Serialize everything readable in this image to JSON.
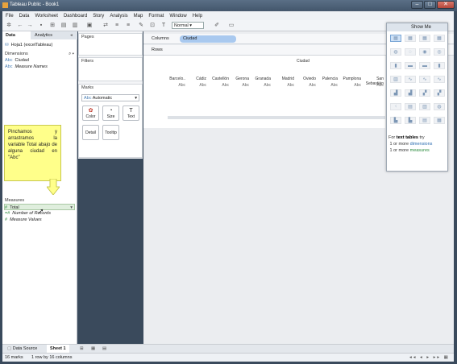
{
  "window": {
    "title": "Tableau Public - Book1"
  },
  "menu": [
    "File",
    "Data",
    "Worksheet",
    "Dashboard",
    "Story",
    "Analysis",
    "Map",
    "Format",
    "Window",
    "Help"
  ],
  "toolbar": {
    "fit_mode": "Normal"
  },
  "left_pane": {
    "tabs": [
      "Data",
      "Analytics"
    ],
    "datasource": "Hoja1 (excelTableau)",
    "dimensions_header": "Dimensions",
    "dimensions": [
      {
        "type": "Abc",
        "name": "Ciudad"
      },
      {
        "type": "Abc",
        "name": "Measure Names"
      }
    ],
    "measures_header": "Measures",
    "measures": [
      {
        "type": "#",
        "name": "Total"
      },
      {
        "type": "=#",
        "name": "Number of Records"
      },
      {
        "type": "#",
        "name": "Measure Values"
      }
    ]
  },
  "cards": {
    "pages": "Pages",
    "filters": "Filters",
    "marks": "Marks",
    "mark_type": "Automatic",
    "mark_type_icon": "Abc",
    "buttons": [
      "Color",
      "Size",
      "Text",
      "Detail",
      "Tooltip"
    ]
  },
  "shelves": {
    "columns_label": "Columns",
    "columns_pill": "Ciudad",
    "rows_label": "Rows"
  },
  "view": {
    "header": "Ciudad",
    "columns": [
      "Barcelo..",
      "Cádiz",
      "Castellón",
      "Gerona",
      "Granada",
      "Madrid",
      "Oviedo",
      "Palencia",
      "Pamplona",
      "San Sebastián"
    ],
    "cell_value": "Abc"
  },
  "show_me": {
    "title": "Show Me",
    "hint_prefix": "For",
    "hint_bold": "text tables",
    "hint_try": "try",
    "hint_line2_pre": "1 or more",
    "hint_line2_link": "dimensions",
    "hint_line3_pre": "1 or more",
    "hint_line3_link": "measures"
  },
  "callout": {
    "text": "Pinchamos y arrastramos la variable Total abajo de alguna ciudad en \"Abc\""
  },
  "sheet_tabs": {
    "data_source": "Data Source",
    "sheet": "Sheet 1"
  },
  "status": {
    "marks": "16 marks",
    "dims": "1 row by 16 columns"
  },
  "colors": {
    "pill": "#a9c9ef",
    "callout": "#ffff8a",
    "dimension": "#2b6cb0",
    "measure": "#2a8a3c"
  }
}
